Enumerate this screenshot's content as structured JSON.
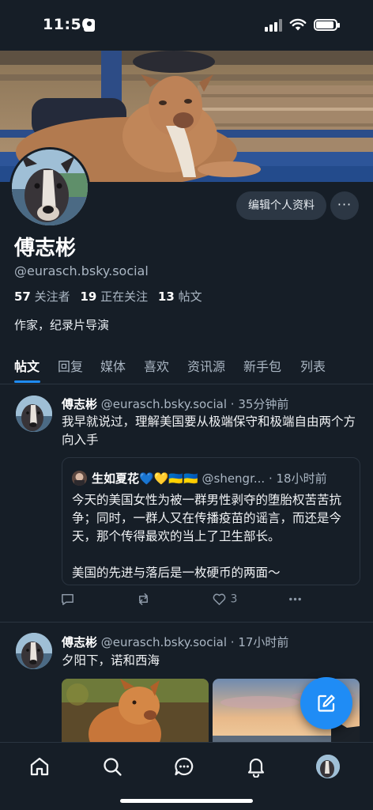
{
  "status_bar": {
    "time": "11:50"
  },
  "profile": {
    "display_name": "傅志彬",
    "handle": "@eurasch.bsky.social",
    "edit_button": "编辑个人资料",
    "more_button": "···",
    "followers_count": "57",
    "followers_label": "关注者",
    "following_count": "19",
    "following_label": "正在关注",
    "posts_count": "13",
    "posts_label": "帖文",
    "bio": "作家，纪录片导演"
  },
  "tabs": [
    "帖文",
    "回复",
    "媒体",
    "喜欢",
    "资讯源",
    "新手包",
    "列表"
  ],
  "active_tab": "帖文",
  "posts": [
    {
      "author_name": "傅志彬",
      "author_handle": "@eurasch.bsky.social",
      "time": "· 35分钟前",
      "text": "我早就说过，理解美国要从极端保守和极端自由两个方向入手",
      "quote": {
        "author_name": "生如夏花💙💛🇺🇦🇺🇦",
        "author_handle": "@shengr...",
        "time": "· 18小时前",
        "paragraph1": "今天的美国女性为被一群男性剥夺的堕胎权苦苦抗争；同时，一群人又在传播疫苗的谣言，而还是今天，那个传得最欢的当上了卫生部长。",
        "paragraph2": "美国的先进与落后是一枚硬币的两面～"
      },
      "like_count": "3"
    },
    {
      "author_name": "傅志彬",
      "author_handle": "@eurasch.bsky.social",
      "time": "· 17小时前",
      "text": "夕阳下，诺和西海"
    }
  ],
  "icons": {
    "reply": "reply-icon",
    "repost": "repost-icon",
    "like": "heart-icon",
    "more": "more-icon",
    "compose": "compose-icon",
    "nav": [
      "home-icon",
      "search-icon",
      "chat-icon",
      "bell-icon",
      "profile-avatar"
    ]
  },
  "colors": {
    "accent": "#1f8cf5",
    "background": "#161e27",
    "muted": "#aab6c3"
  }
}
